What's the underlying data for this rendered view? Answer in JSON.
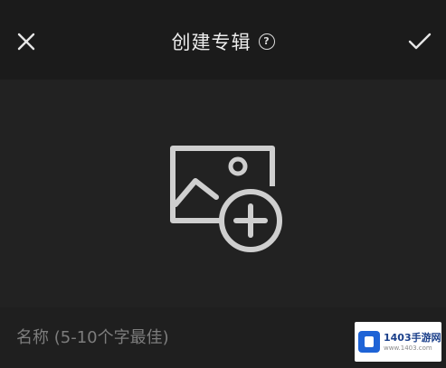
{
  "header": {
    "title": "创建专辑",
    "help_icon": "question-circle-icon",
    "close_icon": "close-icon",
    "confirm_icon": "checkmark-icon"
  },
  "cover": {
    "icon": "add-image-icon"
  },
  "name_field": {
    "value": "",
    "placeholder": "名称 (5-10个字最佳)"
  },
  "watermark": {
    "main": "1403手游网",
    "sub": "www.1403.com"
  },
  "colors": {
    "background": "#1b1b1b",
    "cover_area": "#222222",
    "icon": "#cfcfcf",
    "placeholder": "#7d7d7d"
  }
}
